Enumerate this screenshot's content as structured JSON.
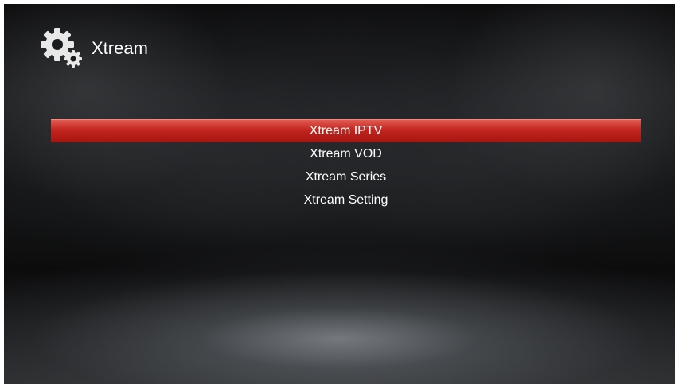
{
  "header": {
    "title": "Xtream",
    "icon": "settings-gears-icon"
  },
  "menu": {
    "selected_index": 0,
    "items": [
      {
        "label": "Xtream IPTV"
      },
      {
        "label": "Xtream VOD"
      },
      {
        "label": "Xtream Series"
      },
      {
        "label": "Xtream Setting"
      }
    ]
  },
  "colors": {
    "highlight": "#c2261f",
    "text": "#ffffff",
    "background": "#141516"
  }
}
